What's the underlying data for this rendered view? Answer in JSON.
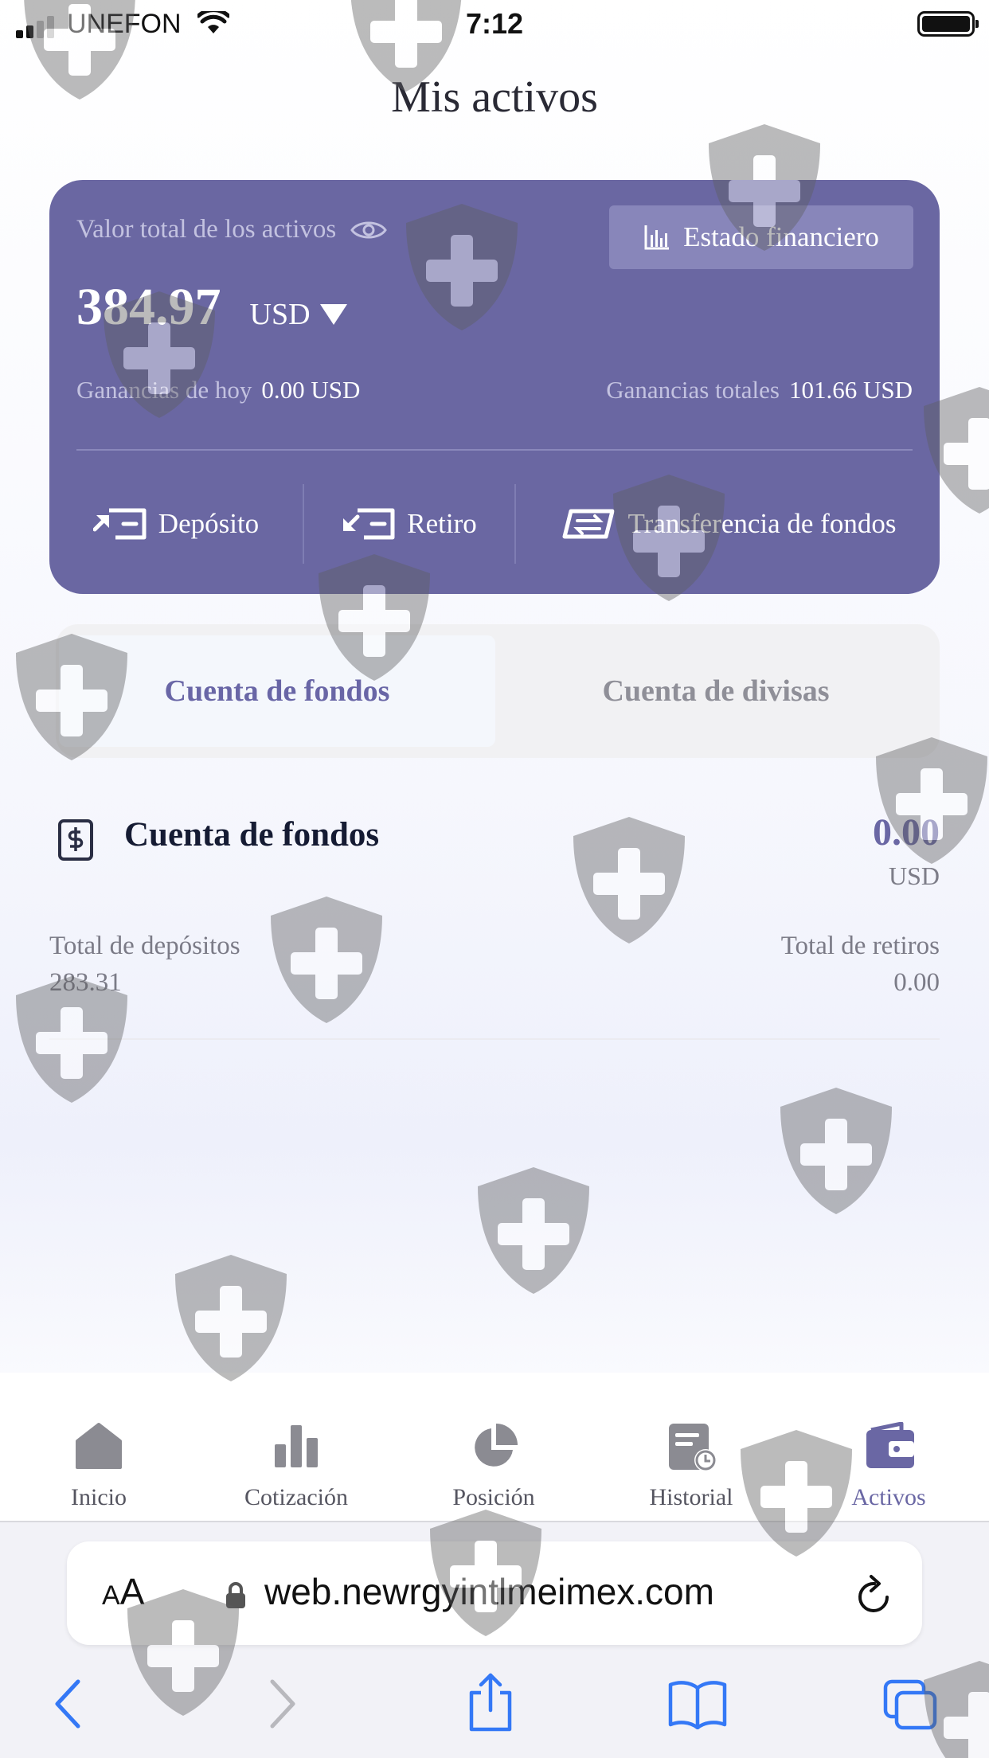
{
  "status_bar": {
    "carrier": "UNEFON",
    "time": "7:12"
  },
  "page_title": "Mis activos",
  "asset_card": {
    "total_label": "Valor total de los activos",
    "statement_button": "Estado financiero",
    "balance": "384.97",
    "currency": "USD",
    "today_label": "Ganancias de hoy",
    "today_value": "0.00 USD",
    "total_gain_label": "Ganancias totales",
    "total_gain_value": "101.66 USD",
    "actions": {
      "deposit": "Depósito",
      "withdraw": "Retiro",
      "transfer": "Transferencia de fondos"
    }
  },
  "tabs": {
    "funds": "Cuenta de fondos",
    "currency": "Cuenta de divisas",
    "active": "funds"
  },
  "fund_account": {
    "title": "Cuenta de fondos",
    "value": "0.00",
    "unit": "USD",
    "deposits_label": "Total de depósitos",
    "deposits_value": "283.31",
    "withdrawals_label": "Total de retiros",
    "withdrawals_value": "0.00"
  },
  "bottom_nav": {
    "items": [
      {
        "label": "Inicio",
        "icon": "home-icon"
      },
      {
        "label": "Cotización",
        "icon": "bar-chart-icon"
      },
      {
        "label": "Posición",
        "icon": "pie-chart-icon"
      },
      {
        "label": "Historial",
        "icon": "history-icon"
      },
      {
        "label": "Activos",
        "icon": "wallet-icon"
      }
    ],
    "active": "Activos"
  },
  "safari": {
    "text_size_button": "AA",
    "url": "web.newrgyintlmeimex.com"
  },
  "colors": {
    "card_bg": "#6a67a2",
    "accent": "#6a67a4",
    "ios_blue": "#3478f6"
  }
}
